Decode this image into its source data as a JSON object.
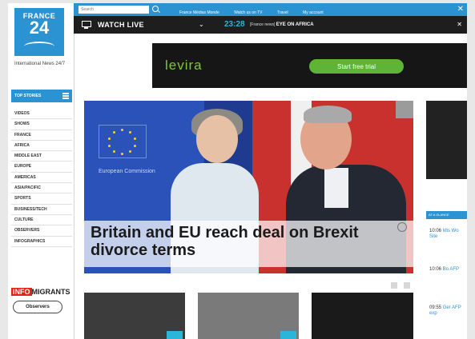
{
  "logo": {
    "line1": "FRANCE",
    "line2": "24",
    "tagline": "International News 24/7"
  },
  "sidebar": {
    "top_stories": "TOP STORIES",
    "items": [
      "VIDEOS",
      "SHOWS",
      "FRANCE",
      "AFRICA",
      "MIDDLE EAST",
      "EUROPE",
      "AMERICAS",
      "ASIA/PACIFIC",
      "SPORTS",
      "BUSINESS/TECH",
      "CULTURE",
      "OBSERVERS",
      "INFOGRAPHICS"
    ],
    "brand_infomigrants": {
      "a": "INFO",
      "b": "MIGRANTS"
    },
    "brand_observers": "Observers"
  },
  "topbar": {
    "search_placeholder": "Search",
    "links": [
      "France Médias Monde",
      "Watch us on TV",
      "Travel",
      "My account"
    ]
  },
  "live": {
    "watch_label": "WATCH LIVE",
    "time": "23:28",
    "program_prefix": "[France news]",
    "program": "EYE ON AFRICA"
  },
  "ad": {
    "brand": "levira",
    "cta": "Start free trial"
  },
  "hero": {
    "title": "Britain and EU reach deal on Brexit divorce terms",
    "backdrop_text": "European Commission"
  },
  "right_column": {
    "header": "AT A GLANCE",
    "news": [
      {
        "time": "10:06",
        "text": "Mis Wo Site"
      },
      {
        "time": "10:06",
        "text": "Bo AFP"
      },
      {
        "time": "09:55",
        "text": "Ger AFP exp"
      }
    ]
  },
  "colors": {
    "accent": "#2b93d1",
    "live_bar": "#1e1e1e",
    "ad_green": "#5db436"
  }
}
